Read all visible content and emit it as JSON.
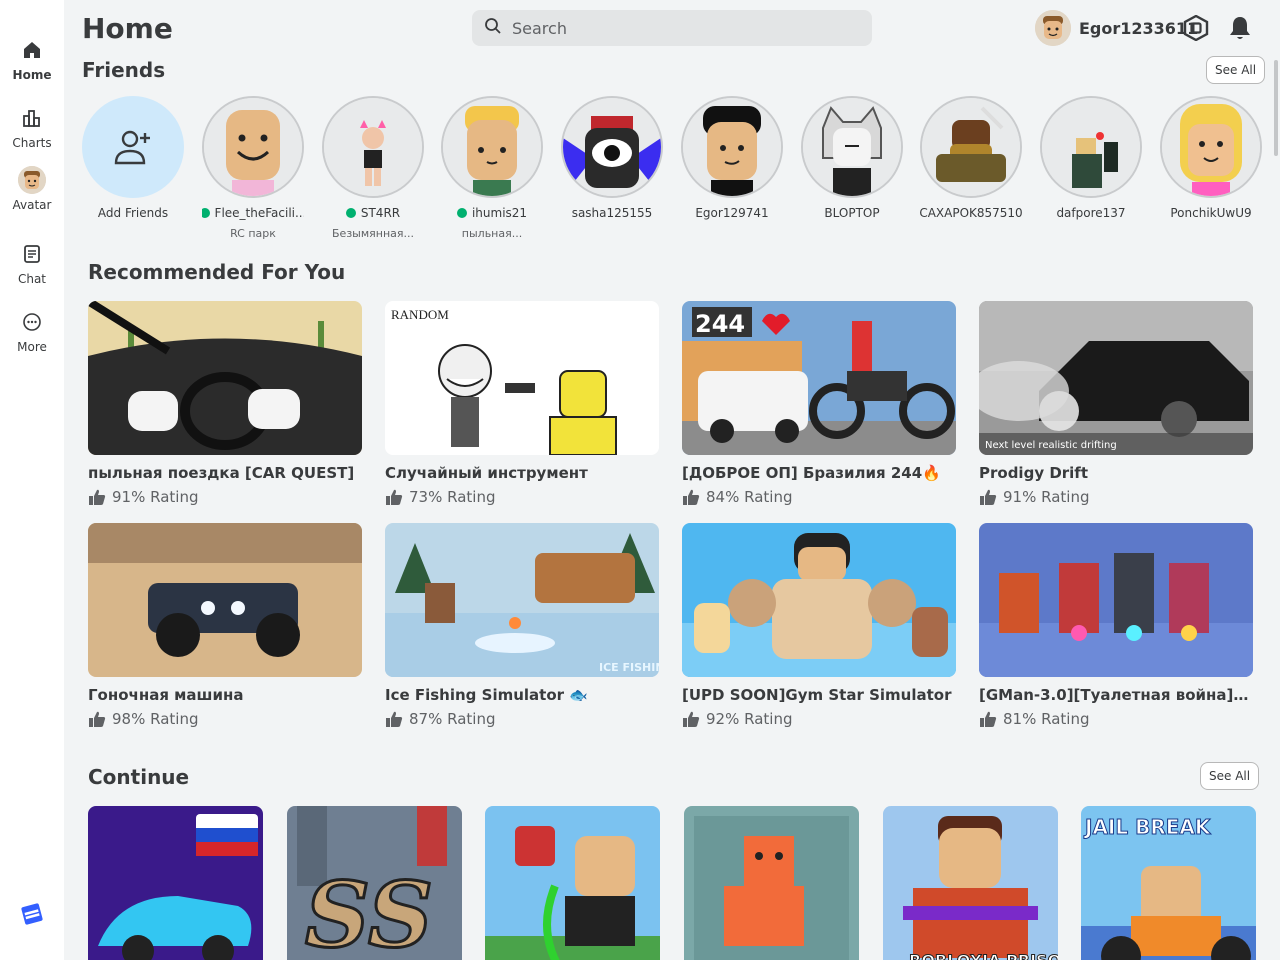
{
  "sidebar": {
    "items": [
      {
        "label": "Home",
        "icon": "home-icon",
        "active": true
      },
      {
        "label": "Charts",
        "icon": "charts-icon",
        "active": false
      },
      {
        "label": "Avatar",
        "icon": "avatar-icon",
        "active": false
      },
      {
        "label": "Chat",
        "icon": "chat-icon",
        "active": false
      },
      {
        "label": "More",
        "icon": "more-icon",
        "active": false
      }
    ]
  },
  "header": {
    "title": "Home",
    "search_placeholder": "Search",
    "username": "Egor1233611"
  },
  "friends": {
    "title": "Friends",
    "see_all": "See All",
    "add_label": "Add Friends",
    "items": [
      {
        "name": "Flee_theFacili...",
        "status": "RC парк",
        "online": true
      },
      {
        "name": "ST4RR",
        "status": "Безымянная...",
        "online": true
      },
      {
        "name": "ihumis21",
        "status": "пыльная...",
        "online": true
      },
      {
        "name": "sasha125155",
        "status": "",
        "online": false
      },
      {
        "name": "Egor129741",
        "status": "",
        "online": false
      },
      {
        "name": "BLOPTOP",
        "status": "",
        "online": false
      },
      {
        "name": "CAXAPOK857510",
        "status": "",
        "online": false
      },
      {
        "name": "dafpore137",
        "status": "",
        "online": false
      },
      {
        "name": "PonchikUwU9",
        "status": "",
        "online": false
      }
    ]
  },
  "recommended": {
    "title": "Recommended For You",
    "games": [
      {
        "title": "пыльная поездка [CAR QUEST]",
        "rating": "91% Rating"
      },
      {
        "title": "Случайный инструмент",
        "rating": "73% Rating",
        "thumb_text": "RANDOM"
      },
      {
        "title": "[ДОБРОЕ ОП] Бразилия 244🔥",
        "rating": "84% Rating",
        "thumb_text": "244"
      },
      {
        "title": "Prodigy Drift",
        "rating": "91% Rating",
        "thumb_text": "Next level realistic drifting"
      },
      {
        "title": "Гоночная машина",
        "rating": "98% Rating"
      },
      {
        "title": "Ice Fishing Simulator 🐟",
        "rating": "87% Rating",
        "thumb_text": "ICE FISHING"
      },
      {
        "title": "[UPD SOON]Gym Star Simulator",
        "rating": "92% Rating"
      },
      {
        "title": "[GMan-3.0][Туалетная война] Кон...",
        "rating": "81% Rating"
      }
    ]
  },
  "continue": {
    "title": "Continue",
    "see_all": "See All",
    "thumb_texts": [
      "",
      "SS",
      "",
      "",
      "ROBLOXIA PRISON",
      "JAIL BREAK"
    ]
  },
  "colors": {
    "online": "#00b06f",
    "background": "#f2f4f5",
    "text": "#393b3d",
    "accent": "#335fff"
  }
}
